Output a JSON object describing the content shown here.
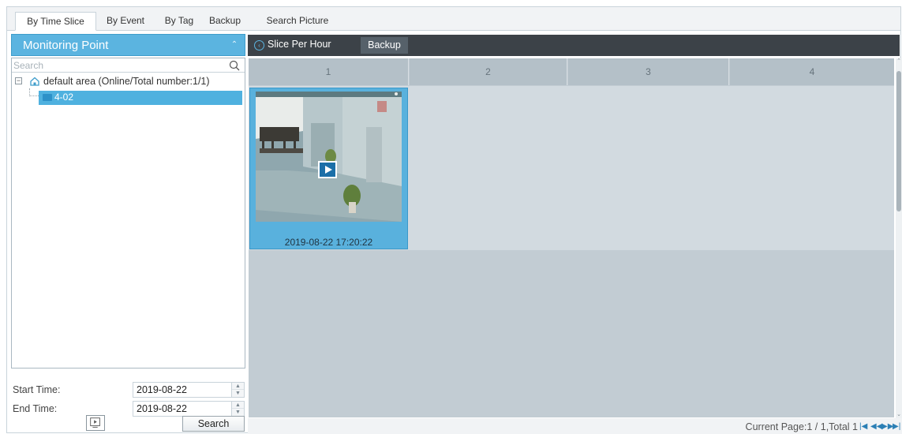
{
  "tabs": [
    "By Time Slice",
    "By Event",
    "By Tag",
    "Backup",
    "Search Picture"
  ],
  "active_tab": "By Time Slice",
  "left_panel": {
    "title": "Monitoring Point",
    "search_placeholder": "Search",
    "tree": {
      "root_label": "default area (Online/Total number:1/1)",
      "children": [
        "4-02"
      ]
    },
    "start_time_label": "Start Time:",
    "start_time_value": "2019-08-22",
    "end_time_label": "End Time:",
    "end_time_value": "2019-08-22",
    "search_button": "Search"
  },
  "toolbar": {
    "slice_label": "Slice Per Hour",
    "backup_label": "Backup"
  },
  "grid": {
    "columns": [
      "1",
      "2",
      "3",
      "4"
    ],
    "thumbnails": [
      {
        "timestamp": "2019-08-22 17:20:22"
      }
    ]
  },
  "pager": {
    "text": "Current Page:1 / 1,Total 1"
  },
  "colors": {
    "accent": "#5bb4e0",
    "toolbar": "#3c4248",
    "grid_bg": "#c2ccd3"
  }
}
